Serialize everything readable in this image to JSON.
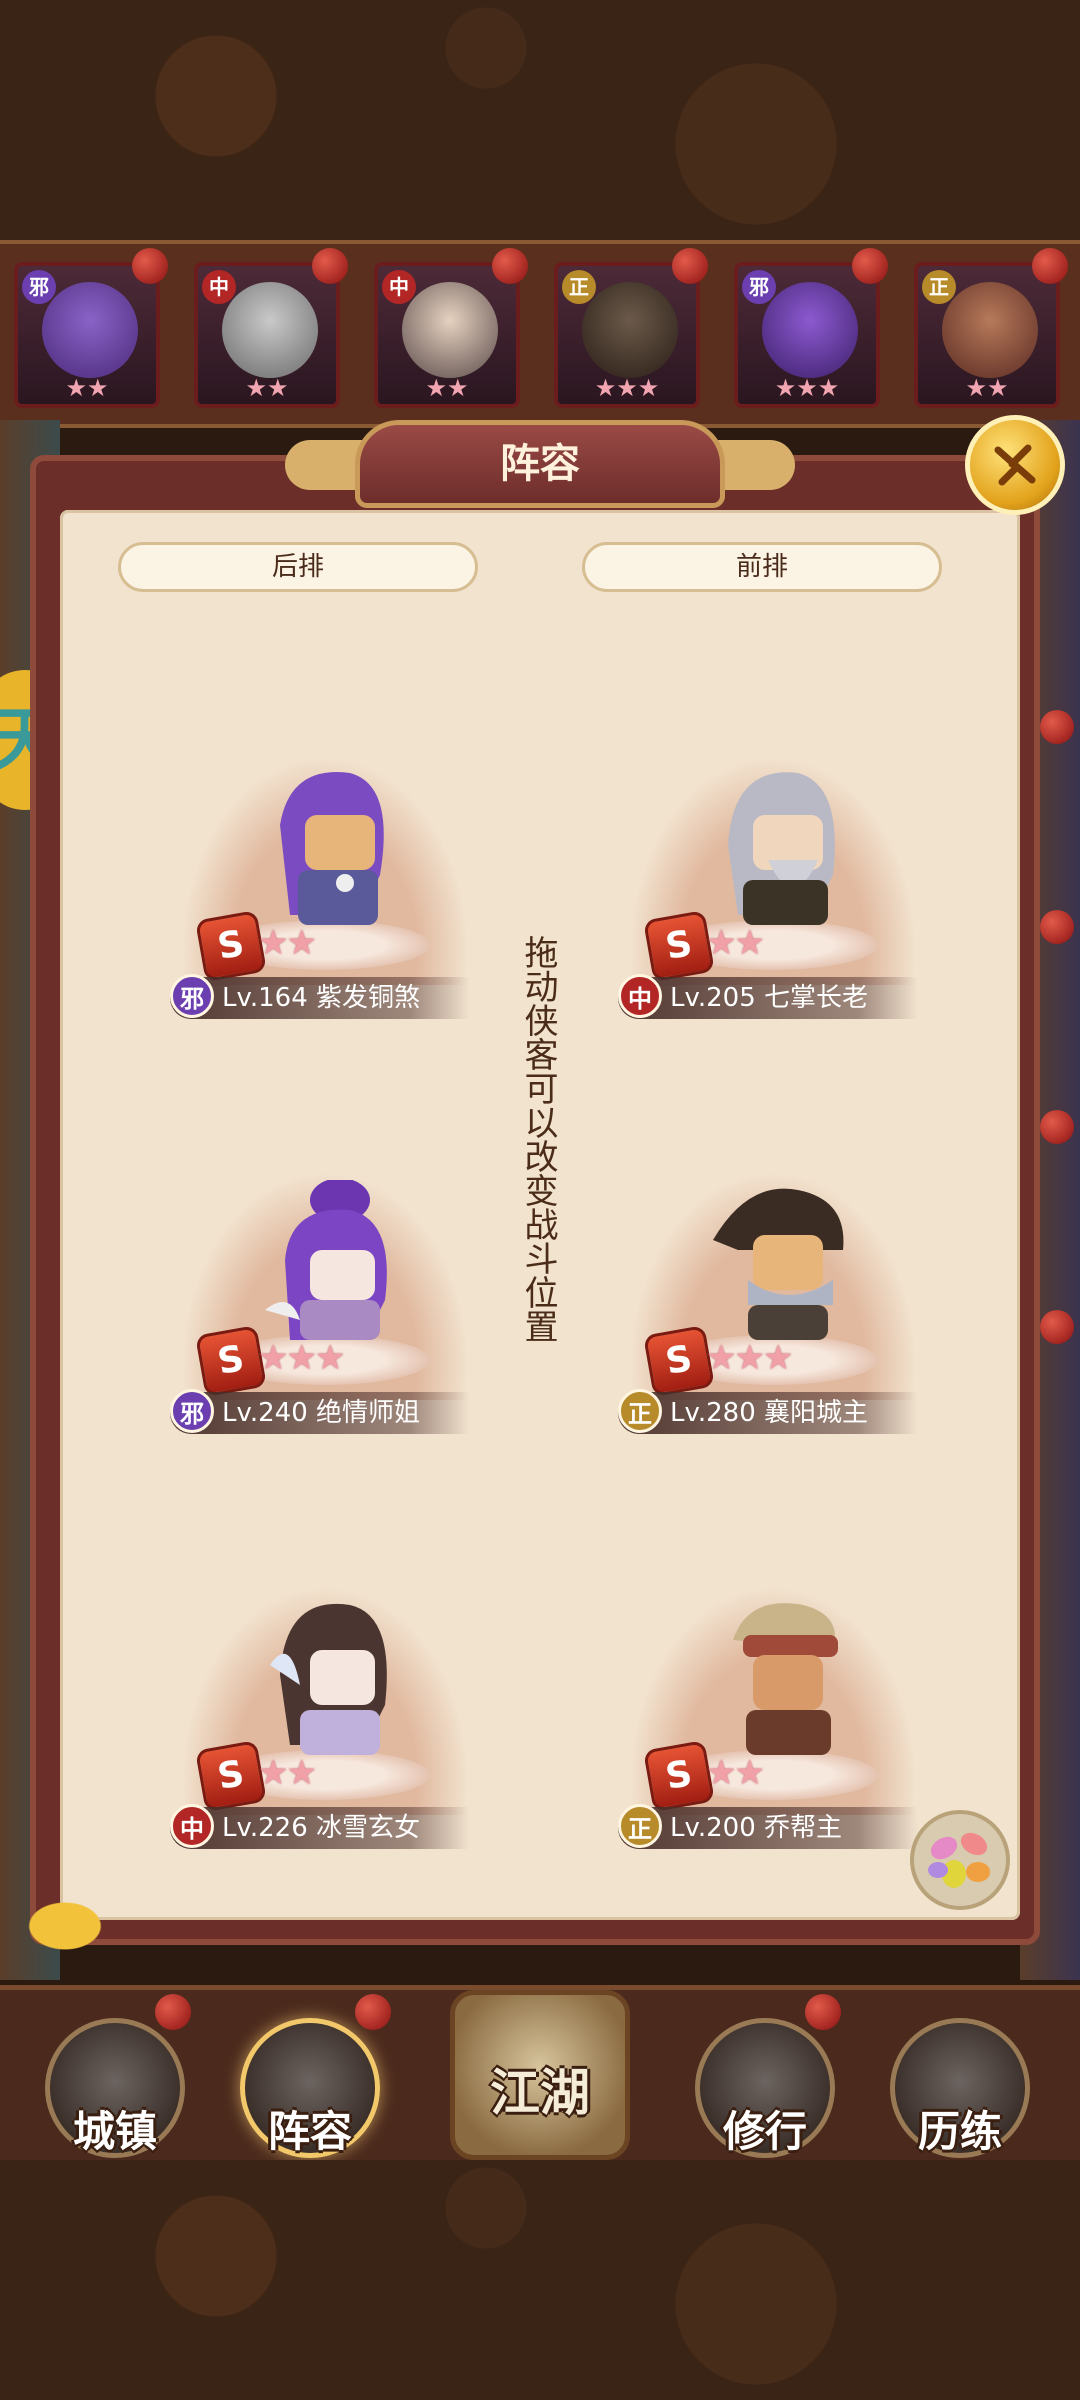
{
  "panel": {
    "title": "阵容",
    "back_row_label": "后排",
    "front_row_label": "前排",
    "drag_hint": "拖动侠客可以改变战斗位置"
  },
  "roster": [
    {
      "faction": "邪",
      "stars": "★★"
    },
    {
      "faction": "中",
      "stars": "★★"
    },
    {
      "faction": "中",
      "stars": "★★"
    },
    {
      "faction": "正",
      "stars": "★★★"
    },
    {
      "faction": "邪",
      "stars": "★★★"
    },
    {
      "faction": "正",
      "stars": "★★"
    }
  ],
  "heroes": [
    {
      "faction": "邪",
      "faction_color": "#6b3fb0",
      "label": "Lv.164 紫发铜煞",
      "stars": "★★",
      "s_icon": "S"
    },
    {
      "faction": "中",
      "faction_color": "#b32626",
      "label": "Lv.205 七掌长老",
      "stars": "★★",
      "s_icon": "S"
    },
    {
      "faction": "邪",
      "faction_color": "#6b3fb0",
      "label": "Lv.240 绝情师姐",
      "stars": "★★★",
      "s_icon": "S"
    },
    {
      "faction": "正",
      "faction_color": "#b78a2a",
      "label": "Lv.280 襄阳城主",
      "stars": "★★★",
      "s_icon": "S"
    },
    {
      "faction": "中",
      "faction_color": "#b32626",
      "label": "Lv.226 冰雪玄女",
      "stars": "★★",
      "s_icon": "S"
    },
    {
      "faction": "正",
      "faction_color": "#b78a2a",
      "label": "Lv.200 乔帮主",
      "stars": "★★",
      "s_icon": "S"
    }
  ],
  "nav": {
    "town": "城镇",
    "lineup": "阵容",
    "jianghu": "江湖",
    "training": "修行",
    "trial": "历练"
  },
  "side_badge": "天",
  "colors": {
    "panel_bg": "#f2e3cf",
    "frame": "#6b2e28",
    "accent_gold": "#e2a21b"
  }
}
